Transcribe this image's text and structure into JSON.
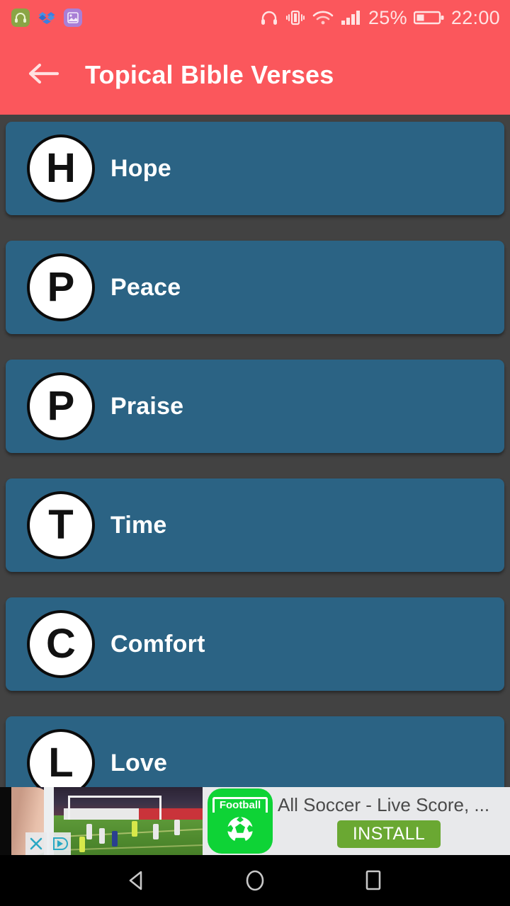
{
  "status_bar": {
    "background": "#fb575c",
    "left_icons": [
      {
        "name": "headphone-app-icon",
        "color": "#8aa545"
      },
      {
        "name": "dropbox-app-icon",
        "color": "#3d7fe0"
      },
      {
        "name": "gallery-app-icon",
        "color": "#a97fd6"
      }
    ],
    "right_icons": [
      {
        "name": "headset-icon"
      },
      {
        "name": "vibrate-icon"
      },
      {
        "name": "wifi-icon"
      },
      {
        "name": "signal-icon"
      }
    ],
    "battery_percent": "25%",
    "time": "22:00"
  },
  "app_bar": {
    "background": "#fb575c",
    "back_label": "back-arrow",
    "title": "Topical Bible Verses"
  },
  "list": {
    "background": "#424242",
    "card_color": "#2b6384",
    "items": [
      {
        "letter": "H",
        "label": "Hope"
      },
      {
        "letter": "P",
        "label": "Peace"
      },
      {
        "letter": "P",
        "label": "Praise"
      },
      {
        "letter": "T",
        "label": "Time"
      },
      {
        "letter": "C",
        "label": "Comfort"
      },
      {
        "letter": "L",
        "label": "Love"
      }
    ]
  },
  "ad": {
    "icon_label": "Football",
    "icon_color": "#0ed336",
    "title": "All Soccer - Live Score, ...",
    "install_label": "INSTALL",
    "install_color": "#6aa832",
    "close_label": "✕",
    "adchoices_label": "adchoices-icon"
  },
  "nav_bar": {
    "buttons": [
      {
        "name": "back-nav-button"
      },
      {
        "name": "home-nav-button"
      },
      {
        "name": "recents-nav-button"
      }
    ]
  }
}
